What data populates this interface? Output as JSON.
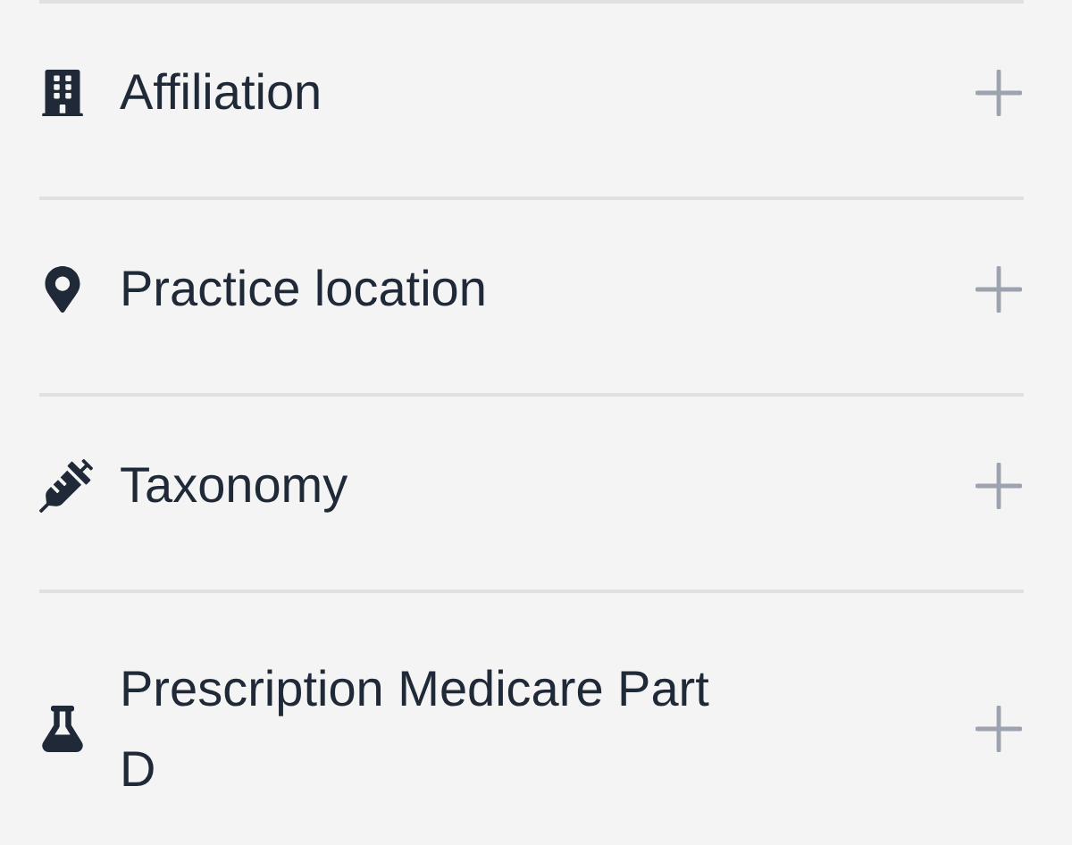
{
  "sections": [
    {
      "label": "Affiliation",
      "expanded": false
    },
    {
      "label": "Practice location",
      "expanded": false
    },
    {
      "label": "Taxonomy",
      "expanded": false
    },
    {
      "label": "Prescription Medicare Part D",
      "expanded": false
    }
  ]
}
